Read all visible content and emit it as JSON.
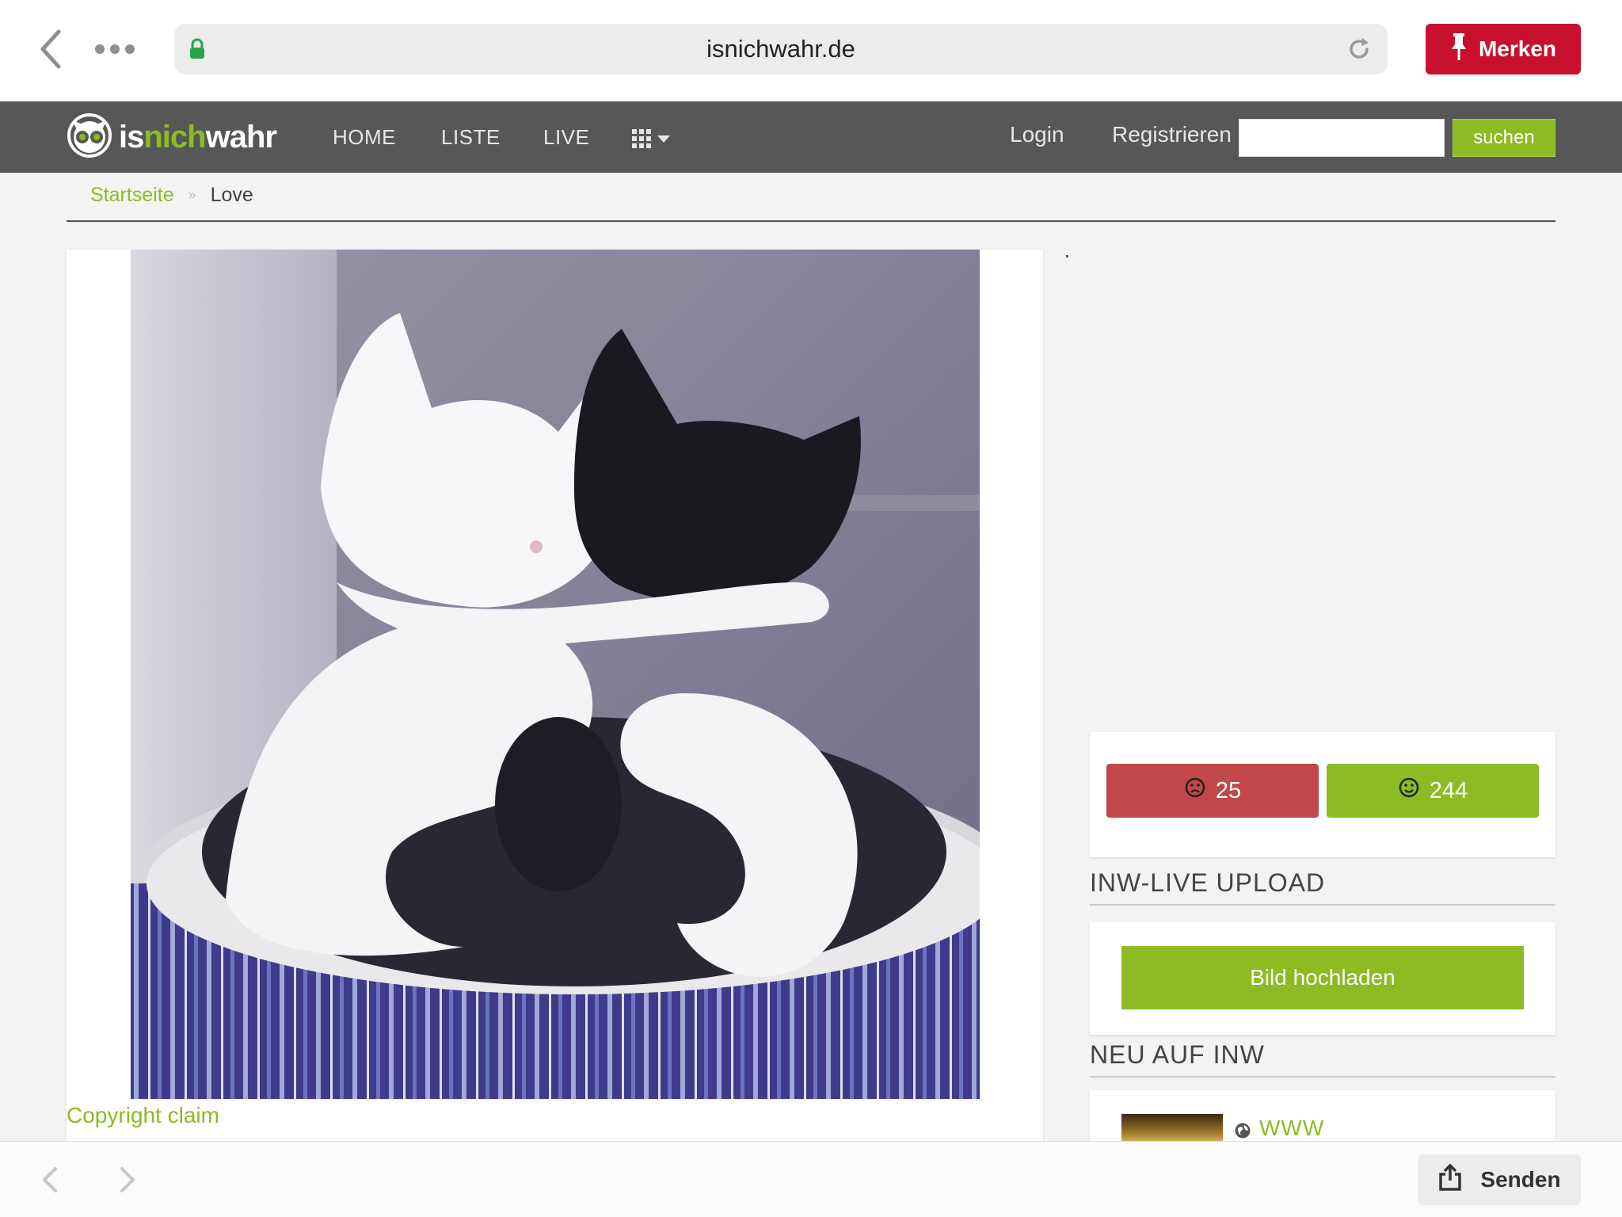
{
  "browser": {
    "url": "isnichwahr.de",
    "save_label": "Merken",
    "share_label": "Senden"
  },
  "site": {
    "logo_parts": [
      "is",
      "nich",
      "wahr"
    ],
    "nav": [
      "HOME",
      "LISTE",
      "LIVE"
    ],
    "login_label": "Login",
    "register_label": "Registrieren",
    "search_value": "",
    "search_button": "suchen"
  },
  "breadcrumb": {
    "home": "Startseite",
    "separator": "»",
    "current": "Love"
  },
  "post": {
    "image_description_icon": "cats-yin-yang-photo",
    "copyright_label": "Copyright claim"
  },
  "votes": {
    "down_count": "25",
    "up_count": "244"
  },
  "sidebar": {
    "live_upload_title": "INW-LIVE UPLOAD",
    "upload_button": "Bild hochladen",
    "new_title": "NEU AUF INW",
    "new_item_label": "WWW"
  },
  "colors": {
    "brand_green": "#8cbb24",
    "nav_bg": "#575757",
    "merken_red": "#c8102e",
    "downvote_red": "#c0484a"
  }
}
